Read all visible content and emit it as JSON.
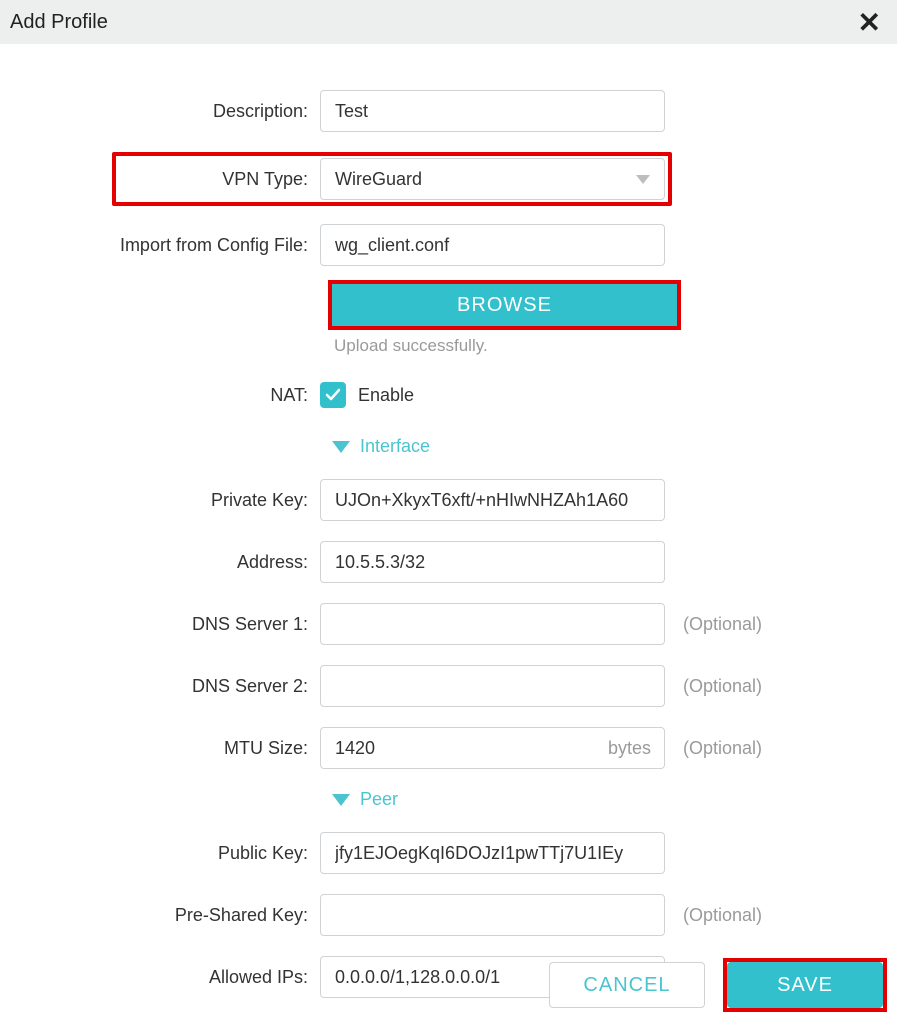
{
  "title": "Add Profile",
  "labels": {
    "description": "Description:",
    "vpn_type": "VPN Type:",
    "import": "Import from Config File:",
    "nat": "NAT:",
    "private_key": "Private Key:",
    "address": "Address:",
    "dns1": "DNS Server 1:",
    "dns2": "DNS Server 2:",
    "mtu": "MTU Size:",
    "public_key": "Public Key:",
    "psk": "Pre-Shared Key:",
    "allowed_ips": "Allowed IPs:"
  },
  "values": {
    "description": "Test",
    "vpn_type": "WireGuard",
    "import": "wg_client.conf",
    "private_key": "UJOn+XkyxT6xft/+nHIwNHZAh1A60",
    "address": "10.5.5.3/32",
    "dns1": "",
    "dns2": "",
    "mtu": "1420",
    "public_key": "jfy1EJOegKqI6DOJzI1pwTTj7U1IEy",
    "psk": "",
    "allowed_ips": "0.0.0.0/1,128.0.0.0/1"
  },
  "optional_text": "(Optional)",
  "mtu_unit": "bytes",
  "browse_label": "BROWSE",
  "upload_status": "Upload successfully.",
  "nat_enable_label": "Enable",
  "sections": {
    "interface": "Interface",
    "peer": "Peer"
  },
  "buttons": {
    "cancel": "CANCEL",
    "save": "SAVE"
  }
}
